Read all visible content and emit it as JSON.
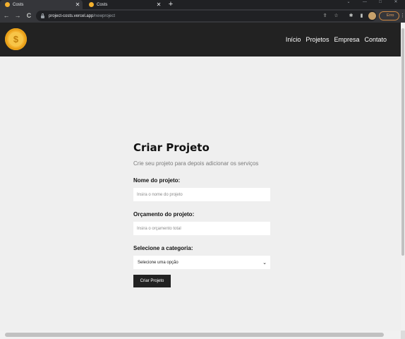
{
  "browser": {
    "tabs": [
      {
        "title": "Costs",
        "active": true
      },
      {
        "title": "Costs",
        "active": false
      }
    ],
    "new_tab_label": "+",
    "window_controls": {
      "minimize": "—",
      "maximize": "□",
      "close": "✕",
      "dropdown": "⌄"
    },
    "nav": {
      "back": "←",
      "forward": "→",
      "reload": "C"
    },
    "url_host": "project-costs.vercel.app",
    "url_path": "/newproject",
    "error_label": "Erro",
    "menu_label": "⋮"
  },
  "site": {
    "logo_symbol": "$",
    "nav_links": [
      "Início",
      "Projetos",
      "Empresa",
      "Contato"
    ]
  },
  "form": {
    "title": "Criar Projeto",
    "subtitle": "Crie seu projeto para depois adicionar os serviços",
    "name_label": "Nome do projeto:",
    "name_placeholder": "Insira o nome do projeto",
    "budget_label": "Orçamento do projeto:",
    "budget_placeholder": "Insira o orçamento total",
    "category_label": "Selecione a categoria:",
    "category_selected": "Selecione uma opção",
    "submit_label": "Criar Projeto"
  },
  "colors": {
    "navbar_bg": "#222222",
    "page_bg": "#efefef",
    "button_bg": "#222222",
    "logo_gold": "#f4b12e"
  }
}
